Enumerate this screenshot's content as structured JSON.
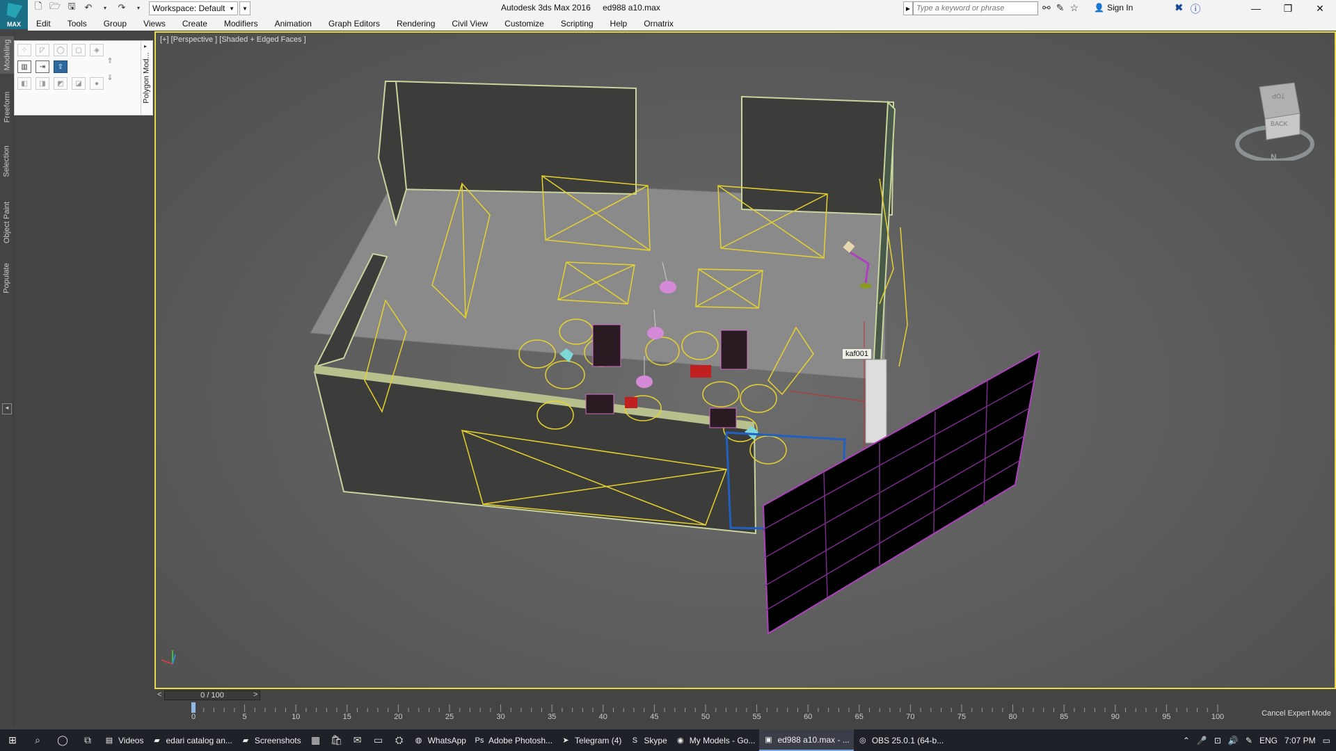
{
  "titlebar": {
    "logo_label": "MAX",
    "workspace": "Workspace: Default",
    "app_name": "Autodesk 3ds Max 2016",
    "file_name": "ed988 a10.max",
    "search_placeholder": "Type a keyword or phrase",
    "sign_in": "Sign In"
  },
  "menu": [
    "Edit",
    "Tools",
    "Group",
    "Views",
    "Create",
    "Modifiers",
    "Animation",
    "Graph Editors",
    "Rendering",
    "Civil View",
    "Customize",
    "Scripting",
    "Help",
    "Ornatrix"
  ],
  "ribbon_tabs": [
    "Modeling",
    "Freeform",
    "Selection",
    "Object Paint",
    "Populate"
  ],
  "ribbon_panel": {
    "title": "Polygon Mod..."
  },
  "viewport": {
    "label": "[+] [Perspective ] [Shaded + Edged Faces ]",
    "selected_object": "kaf001",
    "viewcube_top": "TOP",
    "viewcube_face": "BACK",
    "viewcube_compass": "N"
  },
  "time": {
    "slider_value": "0 / 100",
    "ticks": [
      "0",
      "5",
      "10",
      "15",
      "20",
      "25",
      "30",
      "35",
      "40",
      "45",
      "50",
      "55",
      "60",
      "65",
      "70",
      "75",
      "80",
      "85",
      "90",
      "95",
      "100"
    ],
    "cancel_expert": "Cancel Expert Mode"
  },
  "taskbar": {
    "items": [
      {
        "label": "Videos",
        "icon": "film-icon"
      },
      {
        "label": "edari catalog an...",
        "icon": "folder-icon"
      },
      {
        "label": "Screenshots",
        "icon": "folder-icon"
      },
      {
        "label": "WhatsApp",
        "icon": "whatsapp-icon"
      },
      {
        "label": "Adobe Photosh...",
        "icon": "photoshop-icon"
      },
      {
        "label": "Telegram (4)",
        "icon": "telegram-icon"
      },
      {
        "label": "Skype",
        "icon": "skype-icon"
      },
      {
        "label": "My Models - Go...",
        "icon": "chrome-icon"
      },
      {
        "label": "ed988 a10.max - ...",
        "icon": "3dsmax-icon"
      },
      {
        "label": "OBS 25.0.1 (64-b...",
        "icon": "obs-icon"
      }
    ],
    "language": "ENG",
    "clock": "7:07 PM"
  }
}
